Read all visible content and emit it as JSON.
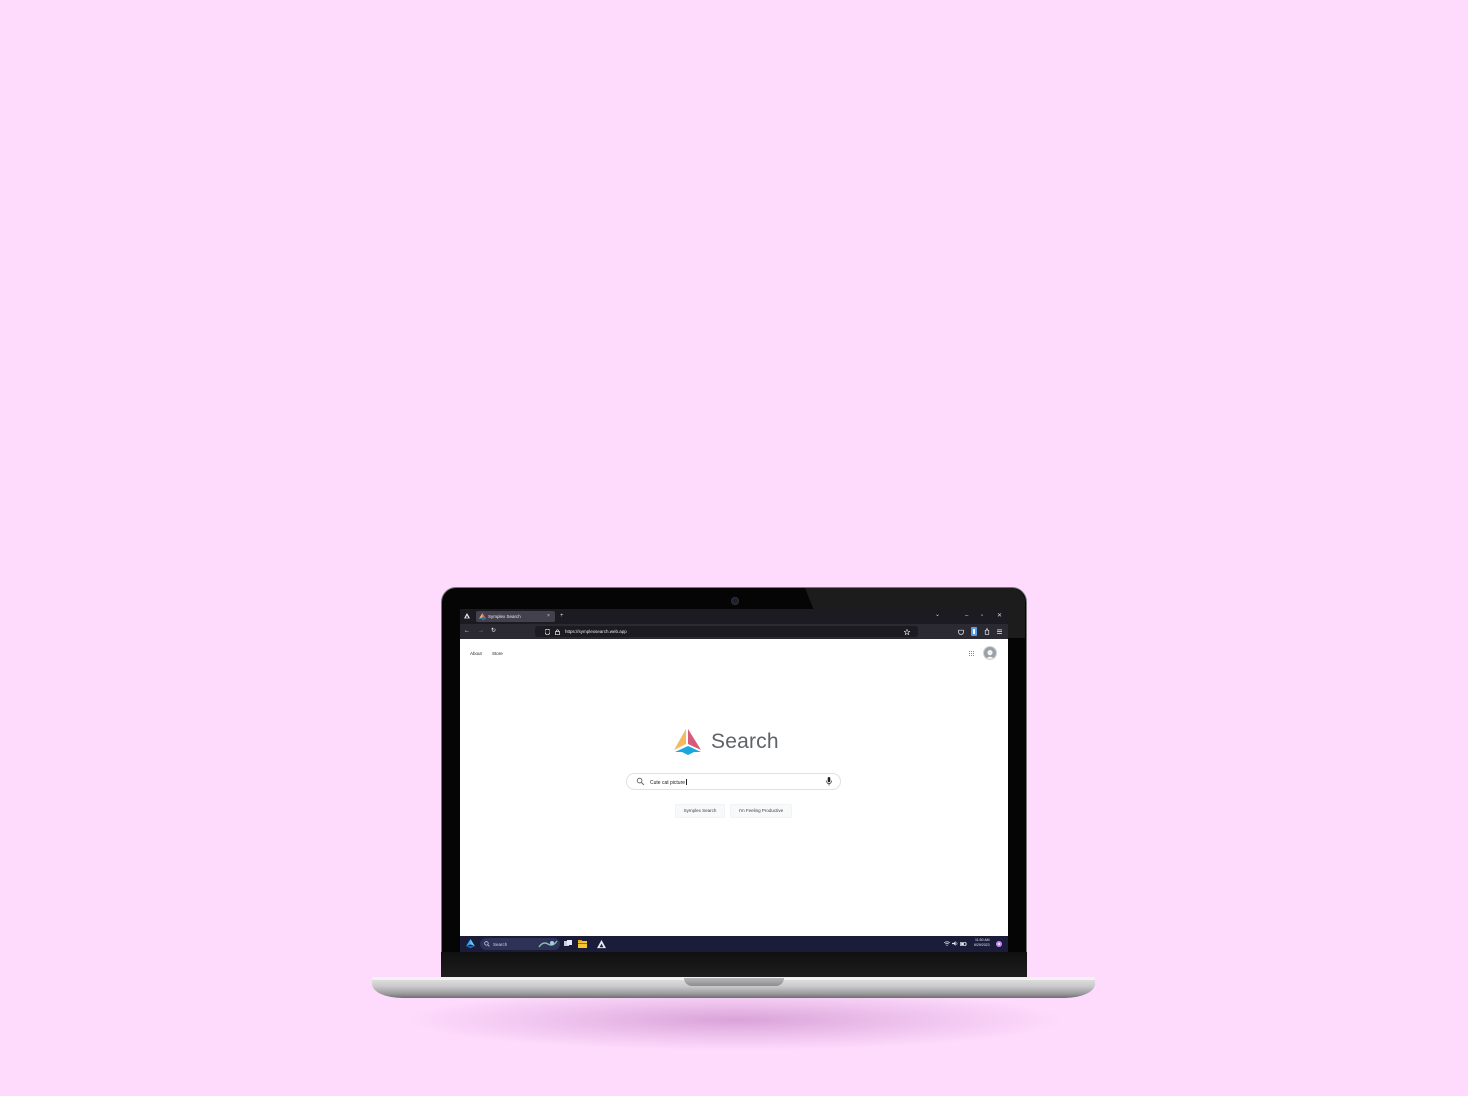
{
  "browser": {
    "tab_title": "Symplex Search",
    "tab_close": "×",
    "new_tab": "+",
    "url": "https://symplexsearch.web.app",
    "window_controls": {
      "list_all_tabs": "⌄",
      "minimize": "–",
      "restore": "▫",
      "close": "✕"
    },
    "nav": {
      "back": "←",
      "forward": "→",
      "reload": "↻"
    }
  },
  "page": {
    "top_links": [
      "About",
      "Store"
    ],
    "brand": "Search",
    "search_value": "Cute cat picture",
    "buttons": [
      "Symplex Search",
      "I'm Feeling Productive"
    ]
  },
  "taskbar": {
    "search_label": "Search",
    "time": "11:50 AM",
    "date": "6/29/2023"
  },
  "colors": {
    "background": "#fedbfd",
    "logo_left": "#f4b860",
    "logo_right": "#d65a7a",
    "logo_bottom": "#1aa7e0",
    "taskbar": "#1a1c3a"
  },
  "icons": [
    "search-icon",
    "mic-icon",
    "apps-grid-icon",
    "avatar-icon",
    "shield-icon",
    "lock-icon",
    "star-icon",
    "menu-icon"
  ]
}
